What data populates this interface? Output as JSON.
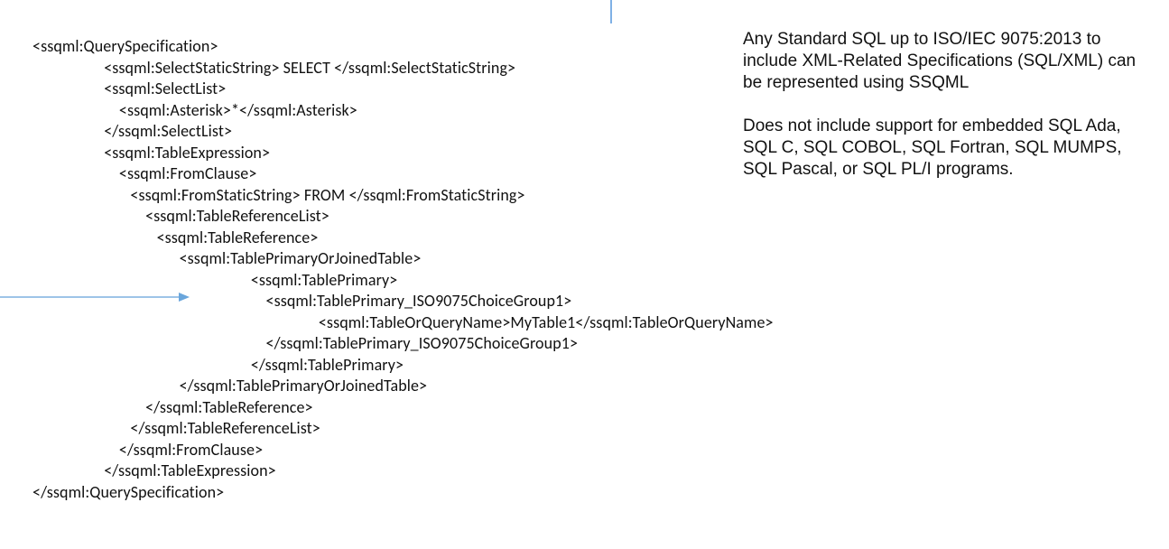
{
  "code": {
    "l1": "<ssqml:QuerySpecification>",
    "l2": "                   <ssqml:SelectStaticString> SELECT </ssqml:SelectStaticString>",
    "l3": "                   <ssqml:SelectList>",
    "l4": "                       <ssqml:Asterisk>*</ssqml:Asterisk>",
    "l5": "                   </ssqml:SelectList>",
    "l6": "                   <ssqml:TableExpression>",
    "l7": "                       <ssqml:FromClause>",
    "l8": "                          <ssqml:FromStaticString> FROM </ssqml:FromStaticString>",
    "l9": "                              <ssqml:TableReferenceList>",
    "l10": "                                 <ssqml:TableReference>",
    "l11": "                                       <ssqml:TablePrimaryOrJoinedTable>",
    "l12": "                                                          <ssqml:TablePrimary>",
    "l13": "                                                              <ssqml:TablePrimary_ISO9075ChoiceGroup1>",
    "l14": "                                                                            <ssqml:TableOrQueryName>MyTable1</ssqml:TableOrQueryName>",
    "l15": "                                                              </ssqml:TablePrimary_ISO9075ChoiceGroup1>",
    "l16": "                                                          </ssqml:TablePrimary>",
    "l17": "                                       </ssqml:TablePrimaryOrJoinedTable>",
    "l18": "                              </ssqml:TableReference>",
    "l19": "                          </ssqml:TableReferenceList>",
    "l20": "                       </ssqml:FromClause>",
    "l21": "                   </ssqml:TableExpression>",
    "l22": "</ssqml:QuerySpecification>"
  },
  "right": {
    "p1": "Any Standard SQL up to ISO/IEC 9075:2013 to include XML-Related Specifications (SQL/XML) can be represented using SSQML",
    "p2": "Does not include support for embedded SQL Ada, SQL C, SQL COBOL, SQL Fortran, SQL MUMPS, SQL Pascal, or SQL PL/I programs."
  }
}
